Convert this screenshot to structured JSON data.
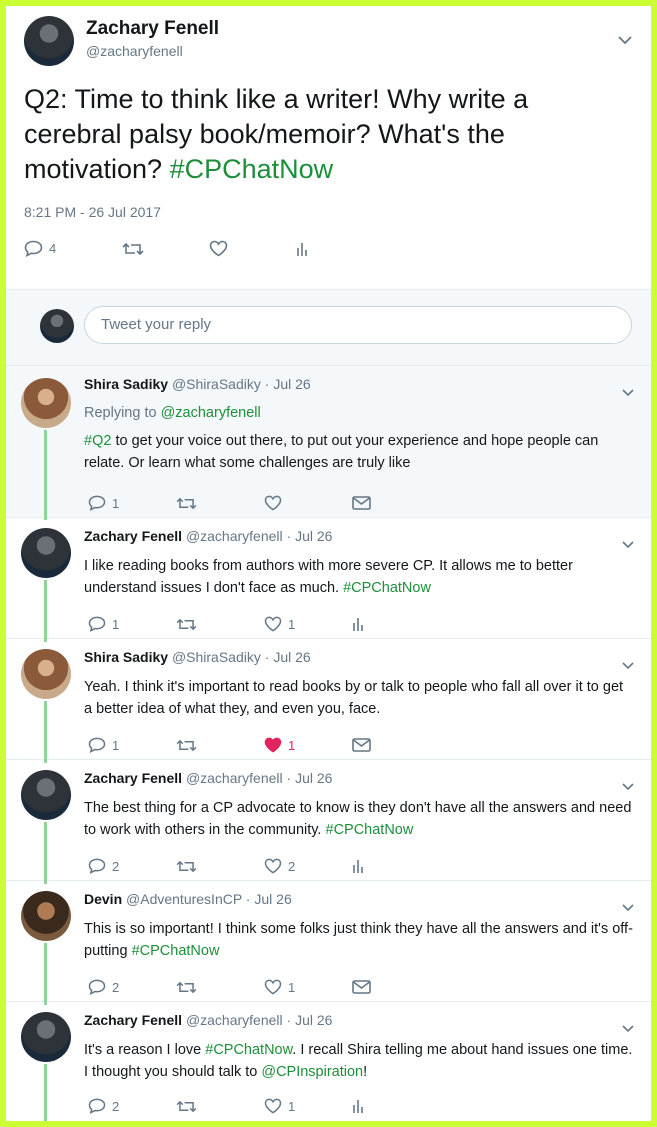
{
  "main_tweet": {
    "author_name": "Zachary Fenell",
    "author_handle": "@zacharyfenell",
    "text_before": "Q2: Time to think like a writer! Why write a cerebral palsy book/memoir? What's the motivation? ",
    "hashtag": "#CPChatNow",
    "timestamp": "8:21 PM - 26 Jul 2017",
    "reply_count": "4"
  },
  "reply_box": {
    "placeholder": "Tweet your reply"
  },
  "replies": [
    {
      "name": "Shira Sadiky",
      "handle": "@ShiraSadiky",
      "date": "Jul 26",
      "replying_to_label": "Replying to ",
      "replying_to": "@zacharyfenell",
      "tag": "#Q2",
      "text": " to get your voice out there, to put out your experience and hope people can relate. Or learn what some challenges are truly like",
      "reply_count": "1",
      "like_count": ""
    },
    {
      "name": "Zachary Fenell",
      "handle": "@zacharyfenell",
      "date": "Jul 26",
      "text": "I like reading books from authors with more severe CP. It allows me to better understand issues I don't face as much. ",
      "tag": "#CPChatNow",
      "reply_count": "1",
      "like_count": "1"
    },
    {
      "name": "Shira Sadiky",
      "handle": "@ShiraSadiky",
      "date": "Jul 26",
      "text": "Yeah.  I think it's important to read books by or talk to people who fall all over it to get a better idea of what they, and even you, face.",
      "reply_count": "1",
      "like_count": "1"
    },
    {
      "name": "Zachary Fenell",
      "handle": "@zacharyfenell",
      "date": "Jul 26",
      "text": "The best thing for a CP advocate to know is they don't have all the answers and need to work with others in the community. ",
      "tag": "#CPChatNow",
      "reply_count": "2",
      "like_count": "2"
    },
    {
      "name": "Devin",
      "handle": "@AdventuresInCP",
      "date": "Jul 26",
      "text": "This is so important! I think some folks just think they have all the answers and it's off-putting ",
      "tag": "#CPChatNow",
      "reply_count": "2",
      "like_count": "1"
    },
    {
      "name": "Zachary Fenell",
      "handle": "@zacharyfenell",
      "date": "Jul 26",
      "text_a": "It's a reason I love ",
      "tag": "#CPChatNow",
      "text_b": ". I recall Shira telling me about hand issues one time. I thought you should talk to ",
      "mention": "@CPInspiration",
      "text_c": "!",
      "reply_count": "2",
      "like_count": "1"
    }
  ],
  "colors": {
    "border": "#ccff33",
    "hashtag": "#1d8f3a",
    "liked": "#e0245e"
  },
  "icons": [
    "reply-icon",
    "retweet-icon",
    "like-icon",
    "analytics-icon",
    "message-icon",
    "chevron-down-icon"
  ]
}
